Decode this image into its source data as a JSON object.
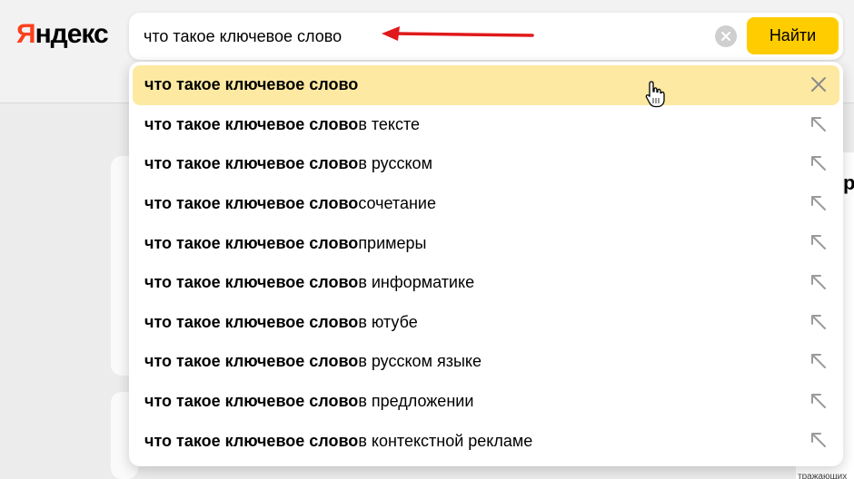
{
  "header": {
    "logo_first": "Я",
    "logo_rest": "ндекс"
  },
  "search": {
    "query": "что такое ключевое слово",
    "find_label": "Найти"
  },
  "suggestions": [
    {
      "bold": "что такое ключевое слово",
      "rest": ""
    },
    {
      "bold": "что такое ключевое слово",
      "rest": " в тексте"
    },
    {
      "bold": "что такое ключевое слово",
      "rest": " в русском"
    },
    {
      "bold": "что такое ключевое слово",
      "rest": "сочетание"
    },
    {
      "bold": "что такое ключевое слово",
      "rest": " примеры"
    },
    {
      "bold": "что такое ключевое слово",
      "rest": " в информатике"
    },
    {
      "bold": "что такое ключевое слово",
      "rest": " в ютубе"
    },
    {
      "bold": "что такое ключевое слово",
      "rest": " в русском языке"
    },
    {
      "bold": "что такое ключевое слово",
      "rest": " в предложении"
    },
    {
      "bold": "что такое ключевое слово",
      "rest": " в контекстной рекламе"
    }
  ],
  "background": {
    "right_heading": "р",
    "bottom_right_text": "тражающих"
  },
  "colors": {
    "accent": "#ffcc00",
    "highlight": "#fde9a2",
    "logo_red": "#fc3f1d",
    "annotation_arrow": "#e0191b"
  }
}
